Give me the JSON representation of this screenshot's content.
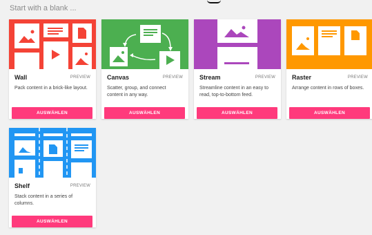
{
  "header": {
    "title": "Start with a blank ..."
  },
  "colors": {
    "wall": "#f44336",
    "canvas": "#4caf50",
    "stream": "#ab47bc",
    "raster": "#ff9800",
    "shelf": "#2196f3",
    "button": "#ff3a7c"
  },
  "cards": [
    {
      "title": "Wall",
      "preview": "PREVIEW",
      "description": "Pack content in a brick-like layout.",
      "button": "AUSWÄHLEN"
    },
    {
      "title": "Canvas",
      "preview": "PREVIEW",
      "description": "Scatter, group, and connect content in any way.",
      "button": "AUSWÄHLEN"
    },
    {
      "title": "Stream",
      "preview": "PREVIEW",
      "description": "Streamline content in an easy to read, top-to-bottom feed.",
      "button": "AUSWÄHLEN"
    },
    {
      "title": "Raster",
      "preview": "PREVIEW",
      "description": "Arrange content in rows of boxes.",
      "button": "AUSWÄHLEN"
    },
    {
      "title": "Shelf",
      "preview": "PREVIEW",
      "description": "Stack content in a series of columns.",
      "button": "AUSWÄHLEN"
    }
  ]
}
